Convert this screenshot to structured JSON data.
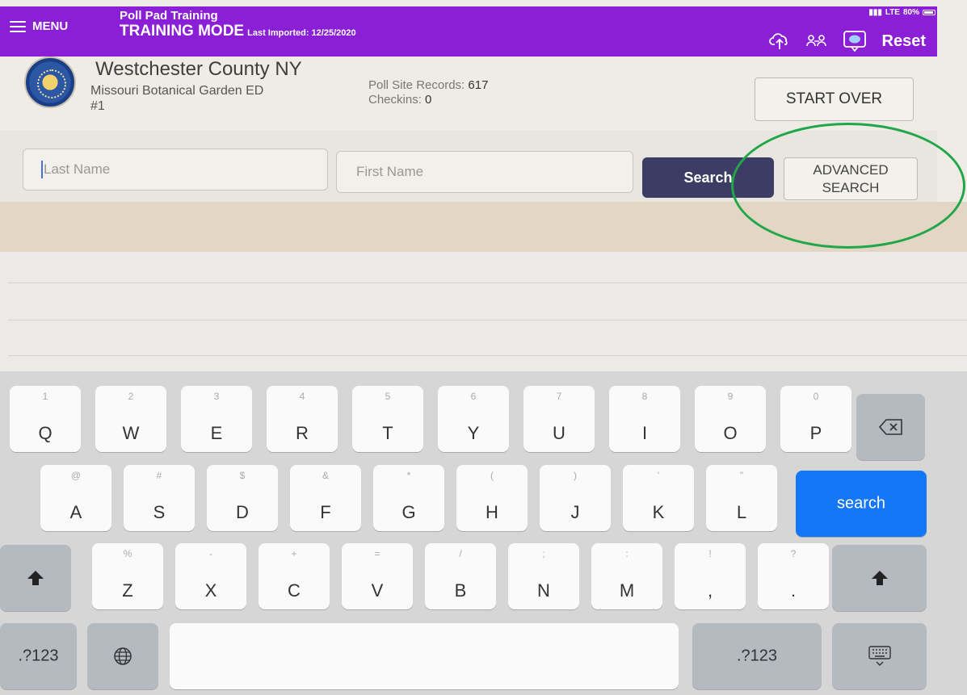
{
  "topbar": {
    "menu_label": "MENU",
    "app_title": "Poll Pad Training",
    "mode": "TRAINING MODE",
    "last_imported": "Last Imported: 12/25/2020",
    "status_text": "LTE",
    "battery_pct": "80%",
    "reset_label": "Reset"
  },
  "header": {
    "county": "Westchester County NY",
    "site_line1": "Missouri Botanical Garden ED",
    "site_line2": "#1",
    "records_label": "Poll Site Records:",
    "records_value": "617",
    "checkins_label": "Checkins:",
    "checkins_value": "0",
    "start_over_label": "START OVER"
  },
  "search": {
    "last_name_placeholder": "Last Name",
    "first_name_placeholder": "First Name",
    "search_label": "Search",
    "advanced_line1": "ADVANCED",
    "advanced_line2": "SEARCH"
  },
  "keyboard": {
    "row1": [
      {
        "hint": "1",
        "key": "Q"
      },
      {
        "hint": "2",
        "key": "W"
      },
      {
        "hint": "3",
        "key": "E"
      },
      {
        "hint": "4",
        "key": "R"
      },
      {
        "hint": "5",
        "key": "T"
      },
      {
        "hint": "6",
        "key": "Y"
      },
      {
        "hint": "7",
        "key": "U"
      },
      {
        "hint": "8",
        "key": "I"
      },
      {
        "hint": "9",
        "key": "O"
      },
      {
        "hint": "0",
        "key": "P"
      }
    ],
    "row2": [
      {
        "hint": "@",
        "key": "A"
      },
      {
        "hint": "#",
        "key": "S"
      },
      {
        "hint": "$",
        "key": "D"
      },
      {
        "hint": "&",
        "key": "F"
      },
      {
        "hint": "*",
        "key": "G"
      },
      {
        "hint": "(",
        "key": "H"
      },
      {
        "hint": ")",
        "key": "J"
      },
      {
        "hint": "'",
        "key": "K"
      },
      {
        "hint": "\"",
        "key": "L"
      }
    ],
    "row3": [
      {
        "hint": "%",
        "key": "Z"
      },
      {
        "hint": "-",
        "key": "X"
      },
      {
        "hint": "+",
        "key": "C"
      },
      {
        "hint": "=",
        "key": "V"
      },
      {
        "hint": "/",
        "key": "B"
      },
      {
        "hint": ";",
        "key": "N"
      },
      {
        "hint": ":",
        "key": "M"
      },
      {
        "hint": "!",
        "key": ","
      },
      {
        "hint": "?",
        "key": "."
      }
    ],
    "search_key": "search",
    "numbers_left": ".?123",
    "numbers_right": ".?123"
  },
  "colors": {
    "topbar": "#8a1fd6",
    "search_button": "#3d3c64",
    "keyboard_search": "#1477f7",
    "highlight": "#22a64a"
  },
  "icons": [
    "menu-icon",
    "cloud-upload-icon",
    "users-icon",
    "chat-icon",
    "backspace-icon",
    "shift-icon",
    "globe-icon",
    "keyboard-dismiss-icon"
  ]
}
